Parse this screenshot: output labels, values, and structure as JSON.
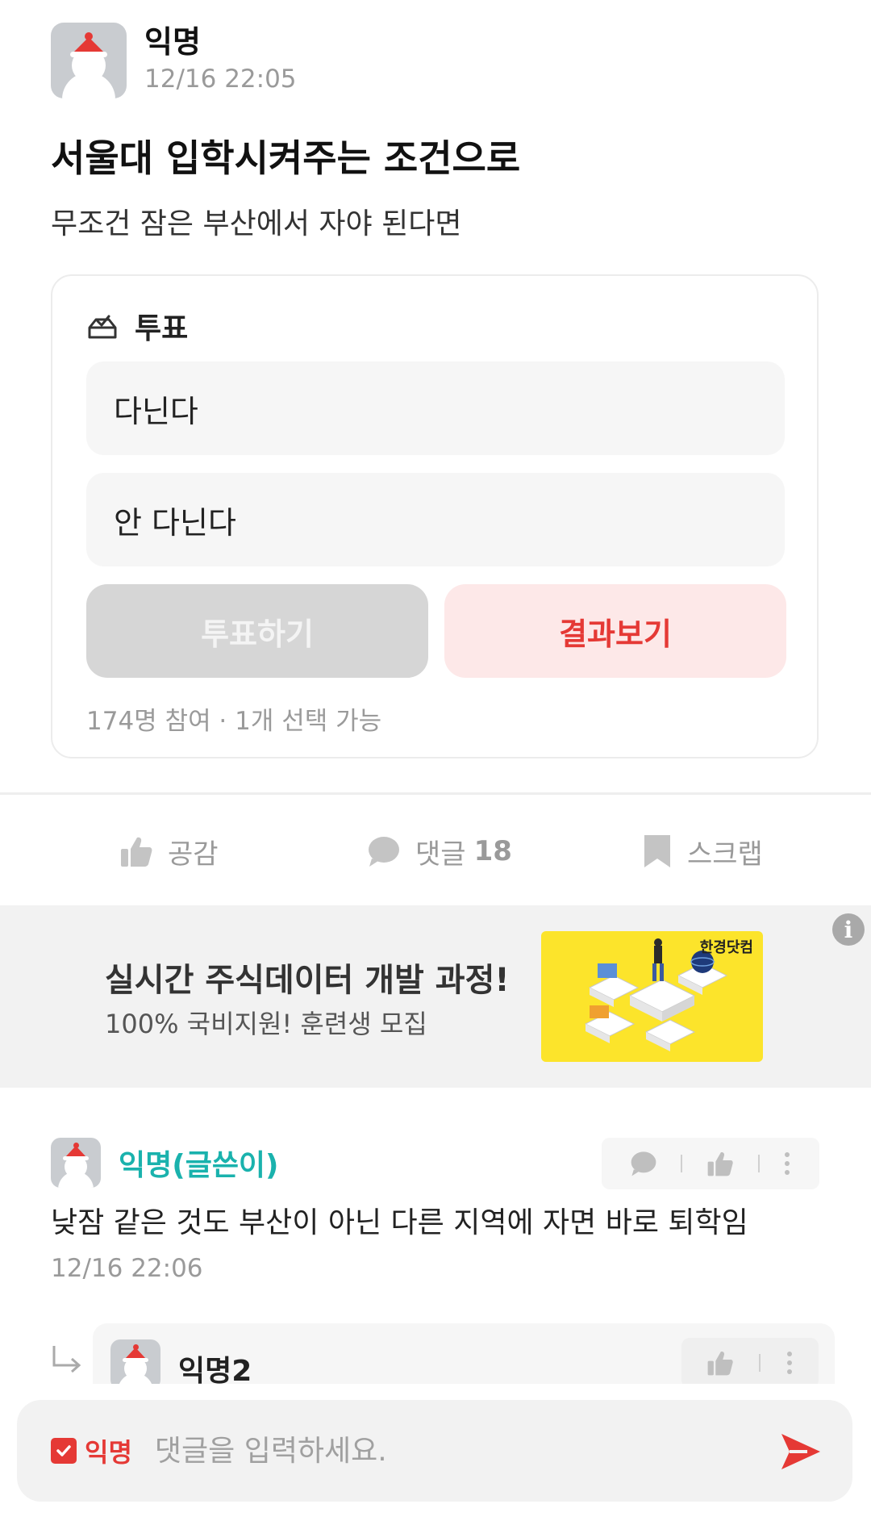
{
  "post": {
    "author": "익명",
    "time": "12/16 22:05",
    "title": "서울대 입학시켜주는 조건으로",
    "body": "무조건 잠은 부산에서 자야 된다면"
  },
  "poll": {
    "title": "투표",
    "options": [
      "다닌다",
      "안 다닌다"
    ],
    "vote_label": "투표하기",
    "result_label": "결과보기",
    "meta": "174명 참여 · 1개 선택 가능"
  },
  "actions": {
    "like_label": "공감",
    "comment_label": "댓글",
    "comment_count": "18",
    "scrap_label": "스크랩"
  },
  "ad": {
    "title": "실시간 주식데이터 개발 과정!",
    "subtitle": "100% 국비지원! 훈련생 모집",
    "brand": "한경닷컴",
    "info_icon": "i"
  },
  "comments": [
    {
      "author": "익명(글쓴이)",
      "text": "낮잠 같은 것도 부산이 아닌 다른 지역에 자면 바로 퇴학임",
      "time": "12/16 22:06"
    }
  ],
  "reply": {
    "author": "익명2"
  },
  "input": {
    "anon_label": "익명",
    "placeholder": "댓글을 입력하세요."
  },
  "colors": {
    "accent": "#e53935",
    "author_teal": "#1ab2ad",
    "muted": "#9a9a9a"
  }
}
